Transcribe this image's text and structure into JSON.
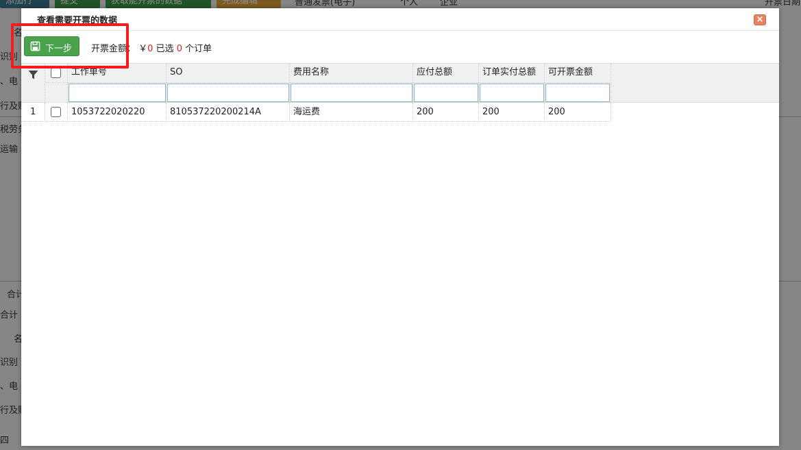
{
  "background": {
    "toolbar": [
      "添加行",
      "提交",
      "获取能开票的数据",
      "完成编辑"
    ],
    "invoice_type": "普通发票(电子)",
    "radio_personal": "个人",
    "radio_company": "企业",
    "fragments": [
      "名",
      "识别",
      "、电",
      "行及账",
      "税劳务",
      "运输",
      "合计",
      "合计",
      "名",
      "识别",
      "、电",
      "行及账",
      "四",
      "开票日期"
    ]
  },
  "modal": {
    "title": "查看需要开票的数据",
    "close_icon": "close-icon",
    "next_button_label": "下一步",
    "summary": {
      "amount_label": "开票金额：",
      "currency": "￥",
      "amount": "0",
      "selected_prefix": "已选",
      "selected_count": "0",
      "selected_suffix": "个订单"
    }
  },
  "grid": {
    "columns": [
      "工作单号",
      "SO",
      "费用名称",
      "应付总额",
      "订单实付总额",
      "可开票金额"
    ],
    "rows": [
      {
        "index": "1",
        "job_no": "1053722020220",
        "so": "810537220200214A",
        "fee_name": "海运费",
        "payable": "200",
        "paid": "200",
        "invoiceable": "200"
      }
    ]
  },
  "colors": {
    "accent_green": "#4aa24a",
    "highlight_red": "#f21c1c",
    "number_red": "#e02020"
  }
}
